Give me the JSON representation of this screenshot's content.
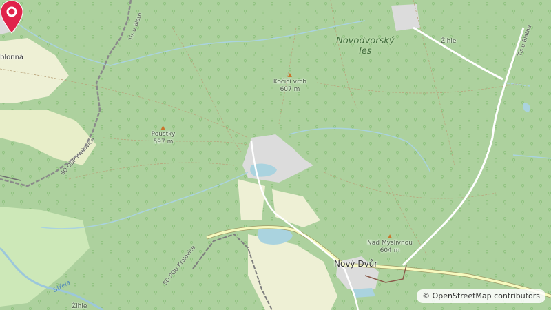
{
  "map": {
    "forest_name": "Novodvorský\nles",
    "peaks": [
      {
        "name": "Kočičí vrch",
        "elevation": "607 m"
      },
      {
        "name": "Poustky",
        "elevation": "597 m"
      },
      {
        "name": "Nad Myslivnou",
        "elevation": "604 m"
      }
    ],
    "places": {
      "blonna": "blonná",
      "novy_dvur": "Nový Dvůr",
      "zihle_top": "Žihle",
      "zihle_bottom": "Žihle"
    },
    "road_labels": {
      "tis_left": "Tis u Blatn",
      "tis_right": "Tis u Blatna",
      "so_obp": "SO OBP Kralovice",
      "so_pou": "SO POU Kralovice"
    },
    "water_label": "Střela",
    "marker": {
      "color": "#e0234a"
    },
    "attribution": "© OpenStreetMap contributors"
  }
}
